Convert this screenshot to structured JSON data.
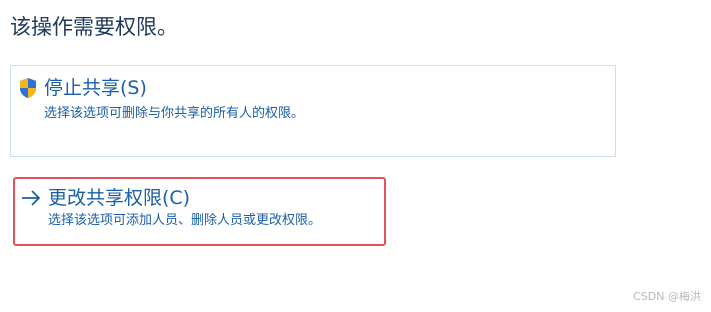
{
  "heading": "该操作需要权限。",
  "options": [
    {
      "title": "停止共享(S)",
      "description": "选择该选项可删除与你共享的所有人的权限。",
      "icon": "uac-shield-icon"
    },
    {
      "title": "更改共享权限(C)",
      "description": "选择该选项可添加人员、删除人员或更改权限。",
      "icon": "arrow-right-icon",
      "highlight_color": "#e2545c"
    }
  ],
  "watermark": "CSDN @梅洪",
  "colors": {
    "heading": "#1e3a5a",
    "link": "#1a5fa8",
    "option_border": "#c9dfee"
  }
}
